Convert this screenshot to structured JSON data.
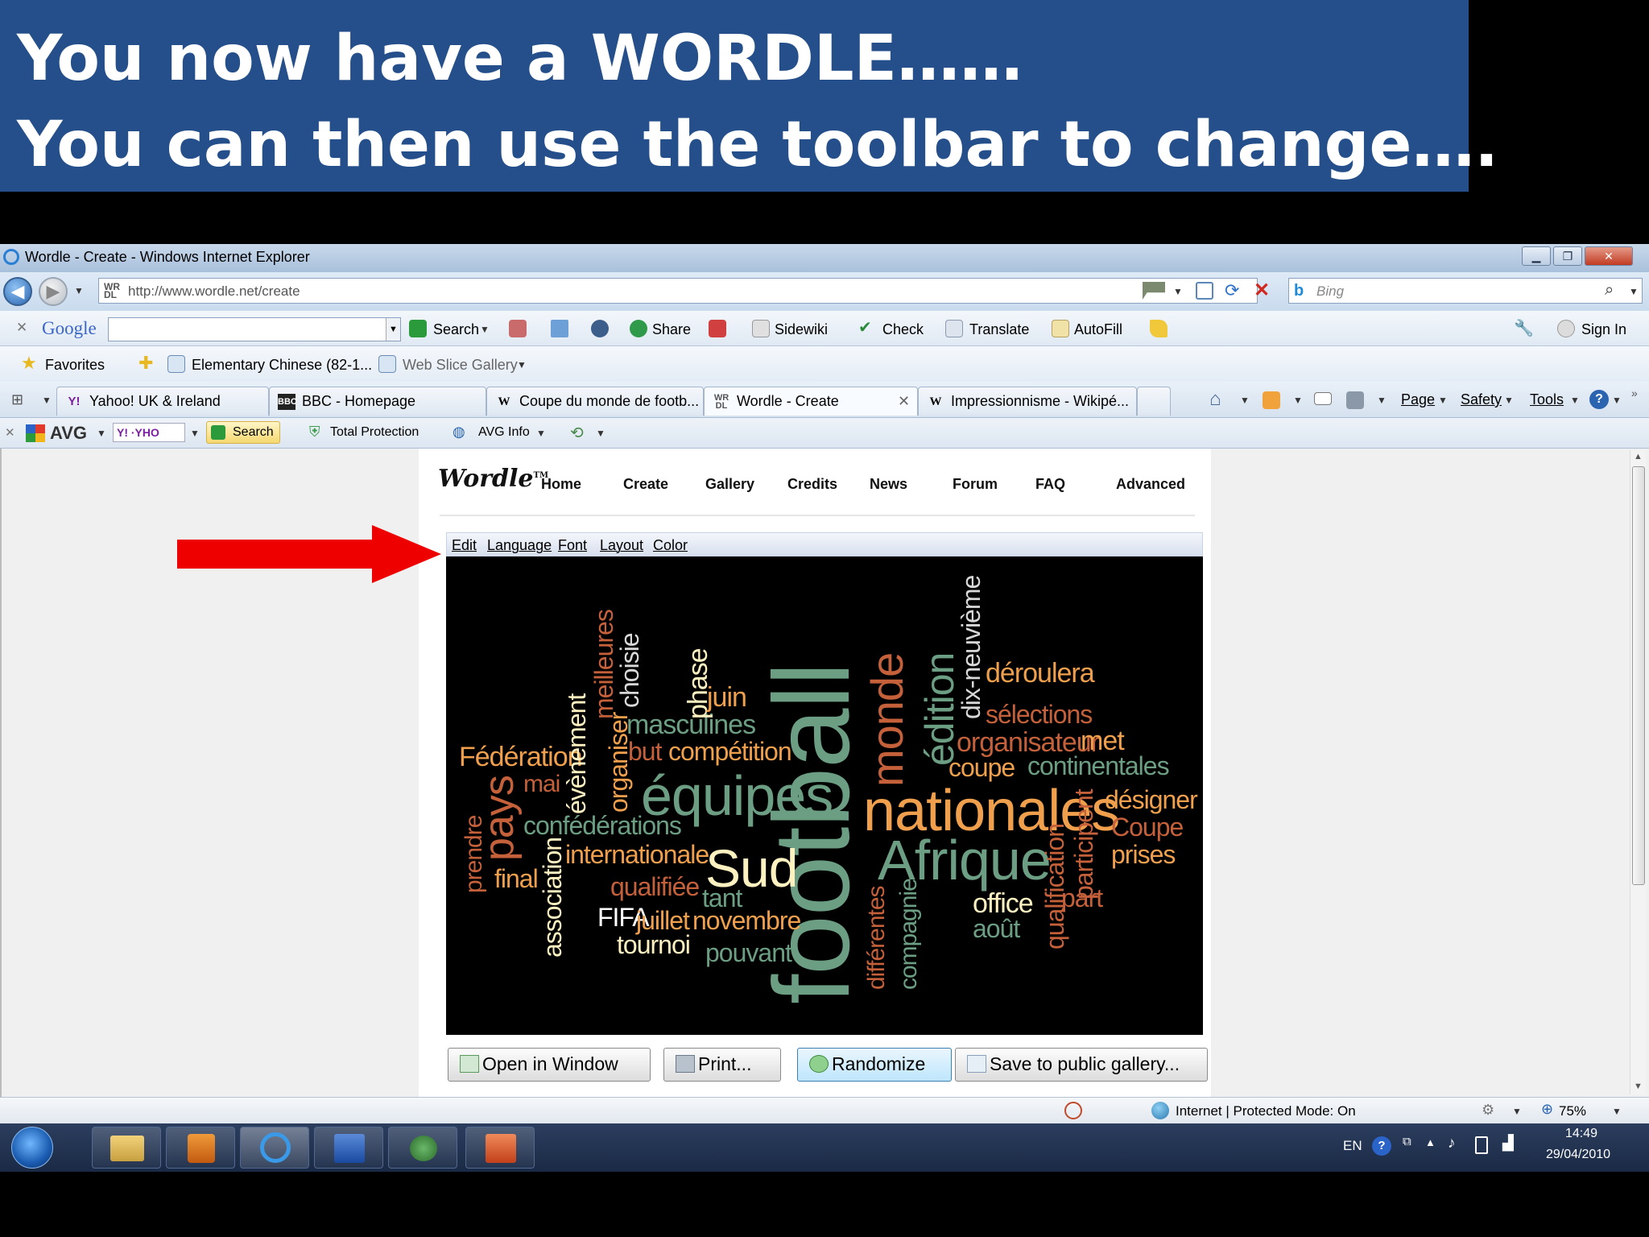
{
  "slide": {
    "line1": "You now have a WORDLE……",
    "line2": "You can then use the toolbar to change…."
  },
  "window": {
    "title": "Wordle - Create - Windows Internet Explorer"
  },
  "address": {
    "prefix": "http://www.wordle.net",
    "path": "/create",
    "search_placeholder": "Bing"
  },
  "google_toolbar": {
    "brand": "Google",
    "search": "Search",
    "share": "Share",
    "sidewiki": "Sidewiki",
    "check": "Check",
    "translate": "Translate",
    "autofill": "AutoFill",
    "sign_in": "Sign In"
  },
  "favorites_bar": {
    "favorites": "Favorites",
    "items": [
      "Elementary Chinese (82-1...",
      "Web Slice Gallery"
    ]
  },
  "tabs": [
    "Yahoo! UK & Ireland",
    "BBC - Homepage",
    "Coupe du monde de footb...",
    "Wordle - Create",
    "Impressionnisme - Wikipé..."
  ],
  "ie_commands": {
    "page": "Page",
    "safety": "Safety",
    "tools": "Tools"
  },
  "avg_toolbar": {
    "brand": "AVG",
    "search": "Search",
    "protection": "Total Protection",
    "info": "AVG Info"
  },
  "wordle": {
    "logo": "Wordle",
    "logo_tm": "TM",
    "nav": [
      "Home",
      "Create",
      "Gallery",
      "Credits",
      "News",
      "Forum",
      "FAQ",
      "Advanced"
    ],
    "menu": [
      "Edit",
      "Language",
      "Font",
      "Layout",
      "Color"
    ],
    "buttons": {
      "open": "Open in Window",
      "print": "Print...",
      "randomize": "Randomize",
      "save": "Save to public gallery..."
    },
    "words": [
      "football",
      "nationales",
      "équipes",
      "Afrique",
      "Sud",
      "monde",
      "édition",
      "pays",
      "internationale",
      "confédérations",
      "continentales",
      "désigner",
      "Coupe",
      "prises",
      "Fédération",
      "masculines",
      "compétition",
      "sélections",
      "déroulera",
      "organisateur",
      "met",
      "coupe",
      "dix-neuvième",
      "phase",
      "choisie",
      "meilleures",
      "juin",
      "but",
      "organiser",
      "évènement",
      "mai",
      "prendre",
      "final",
      "association",
      "qualifiée",
      "FIFA",
      "juillet",
      "novembre",
      "tant",
      "tournoi",
      "pouvant",
      "différentes",
      "compagnie",
      "office",
      "août",
      "qualification",
      "participent",
      "part"
    ]
  },
  "status": {
    "zone": "Internet | Protected Mode: On",
    "zoom": "75%"
  },
  "taskbar": {
    "lang": "EN",
    "time": "14:49",
    "date": "29/04/2010"
  }
}
